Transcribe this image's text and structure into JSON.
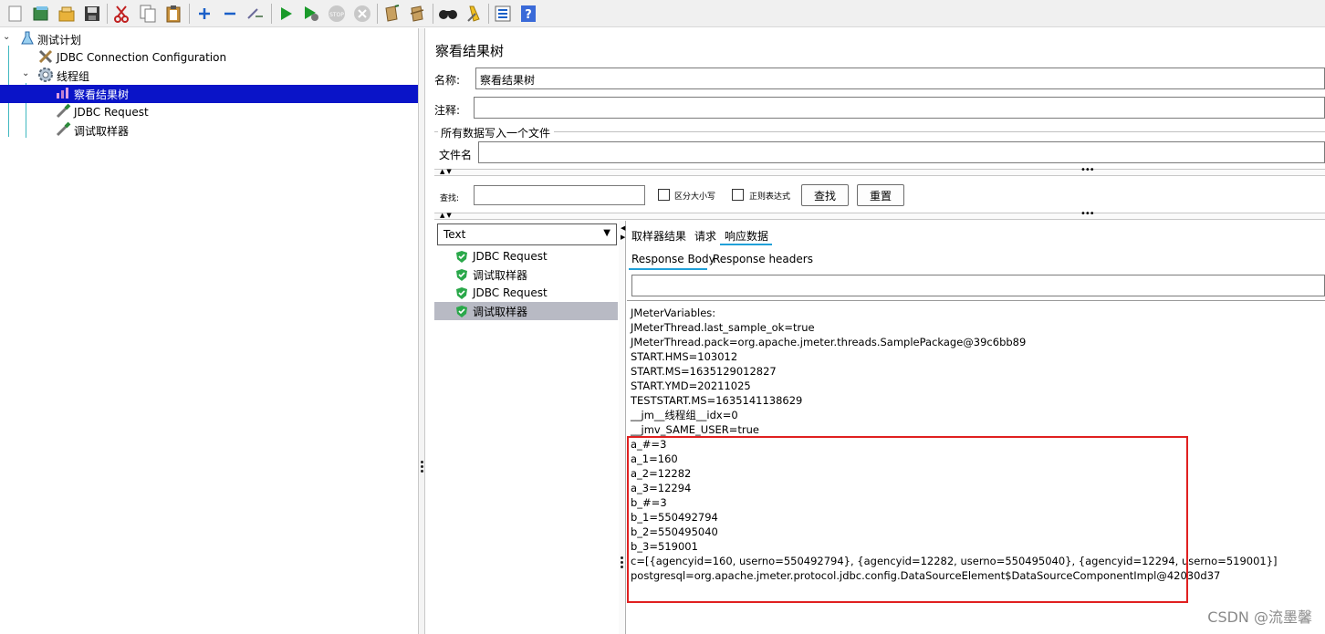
{
  "toolbar": {
    "icons": [
      "new-icon",
      "templates-icon",
      "open-icon",
      "save-icon",
      "cut-icon",
      "copy-icon",
      "paste-icon",
      "expand-icon",
      "collapse-icon",
      "toggle-icon",
      "start-icon",
      "start-no-pause-icon",
      "stop-icon",
      "shutdown-icon",
      "clear-icon",
      "clear-all-icon",
      "search-icon",
      "reset-search-icon",
      "function-helper-icon",
      "help-icon"
    ]
  },
  "tree": {
    "items": [
      {
        "label": "测试计划"
      },
      {
        "label": "JDBC Connection Configuration"
      },
      {
        "label": "线程组"
      },
      {
        "label": "察看结果树",
        "selected": true
      },
      {
        "label": "JDBC Request"
      },
      {
        "label": "调试取样器"
      }
    ]
  },
  "panel": {
    "title": "察看结果树",
    "name_label": "名称:",
    "name_value": "察看结果树",
    "comment_label": "注释:",
    "comment_value": "",
    "file_group_label": "所有数据写入一个文件",
    "file_label": "文件名",
    "file_value": "",
    "search_label": "查找:",
    "search_value": "",
    "case_label": "区分大小写",
    "regex_label": "正则表达式",
    "find_button": "查找",
    "reset_button": "重置"
  },
  "results": {
    "renderer": "Text",
    "items": [
      {
        "label": "JDBC Request"
      },
      {
        "label": "调试取样器"
      },
      {
        "label": "JDBC Request"
      },
      {
        "label": "调试取样器",
        "selected": true
      }
    ]
  },
  "tabs": {
    "sampler_result": "取样器结果",
    "request": "请求",
    "response_data": "响应数据",
    "response_body": "Response Body",
    "response_headers": "Response headers"
  },
  "response_lines": [
    "JMeterVariables:",
    "JMeterThread.last_sample_ok=true",
    "JMeterThread.pack=org.apache.jmeter.threads.SamplePackage@39c6bb89",
    "START.HMS=103012",
    "START.MS=1635129012827",
    "START.YMD=20211025",
    "TESTSTART.MS=1635141138629",
    "__jm__线程组__idx=0",
    "__jmv_SAME_USER=true",
    "a_#=3",
    "a_1=160",
    "a_2=12282",
    "a_3=12294",
    "b_#=3",
    "b_1=550492794",
    "b_2=550495040",
    "b_3=519001",
    "c=[{agencyid=160, userno=550492794}, {agencyid=12282, userno=550495040}, {agencyid=12294, userno=519001}]",
    "postgresql=org.apache.jmeter.protocol.jdbc.config.DataSourceElement$DataSourceComponentImpl@42030d37"
  ],
  "watermark": "CSDN @流墨馨",
  "colors": {
    "selection": "#0a14c8",
    "highlight_box": "#e02020",
    "tab_underline": "#20a0d8",
    "success_shield": "#2aa84a"
  }
}
